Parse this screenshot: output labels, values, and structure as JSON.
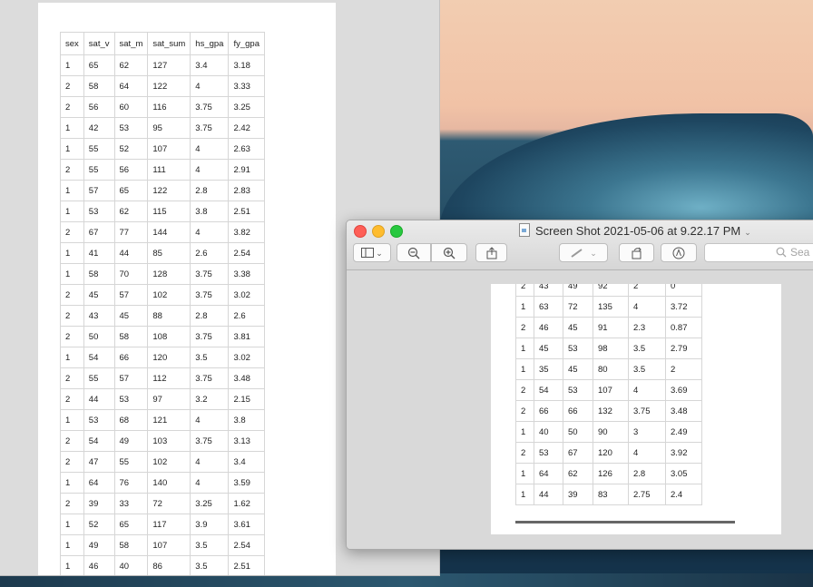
{
  "desktop": {
    "wallpaper": "ocean-wave"
  },
  "left_window": {
    "table": {
      "headers": [
        "sex",
        "sat_v",
        "sat_m",
        "sat_sum",
        "hs_gpa",
        "fy_gpa"
      ],
      "rows": [
        [
          "1",
          "65",
          "62",
          "127",
          "3.4",
          "3.18"
        ],
        [
          "2",
          "58",
          "64",
          "122",
          "4",
          "3.33"
        ],
        [
          "2",
          "56",
          "60",
          "116",
          "3.75",
          "3.25"
        ],
        [
          "1",
          "42",
          "53",
          "95",
          "3.75",
          "2.42"
        ],
        [
          "1",
          "55",
          "52",
          "107",
          "4",
          "2.63"
        ],
        [
          "2",
          "55",
          "56",
          "111",
          "4",
          "2.91"
        ],
        [
          "1",
          "57",
          "65",
          "122",
          "2.8",
          "2.83"
        ],
        [
          "1",
          "53",
          "62",
          "115",
          "3.8",
          "2.51"
        ],
        [
          "2",
          "67",
          "77",
          "144",
          "4",
          "3.82"
        ],
        [
          "1",
          "41",
          "44",
          "85",
          "2.6",
          "2.54"
        ],
        [
          "1",
          "58",
          "70",
          "128",
          "3.75",
          "3.38"
        ],
        [
          "2",
          "45",
          "57",
          "102",
          "3.75",
          "3.02"
        ],
        [
          "2",
          "43",
          "45",
          "88",
          "2.8",
          "2.6"
        ],
        [
          "2",
          "50",
          "58",
          "108",
          "3.75",
          "3.81"
        ],
        [
          "1",
          "54",
          "66",
          "120",
          "3.5",
          "3.02"
        ],
        [
          "2",
          "55",
          "57",
          "112",
          "3.75",
          "3.48"
        ],
        [
          "2",
          "44",
          "53",
          "97",
          "3.2",
          "2.15"
        ],
        [
          "1",
          "53",
          "68",
          "121",
          "4",
          "3.8"
        ],
        [
          "2",
          "54",
          "49",
          "103",
          "3.75",
          "3.13"
        ],
        [
          "2",
          "47",
          "55",
          "102",
          "4",
          "3.4"
        ],
        [
          "1",
          "64",
          "76",
          "140",
          "4",
          "3.59"
        ],
        [
          "2",
          "39",
          "33",
          "72",
          "3.25",
          "1.62"
        ],
        [
          "1",
          "52",
          "65",
          "117",
          "3.9",
          "3.61"
        ],
        [
          "1",
          "49",
          "58",
          "107",
          "3.5",
          "2.54"
        ],
        [
          "1",
          "46",
          "40",
          "86",
          "3.5",
          "2.51"
        ]
      ]
    }
  },
  "preview_window": {
    "title": "Screen Shot 2021-05-06 at 9.22.17 PM",
    "title_chevron": "⌄",
    "search_placeholder": "Sea",
    "toolbar": {
      "sidebar_chevron": "⌄",
      "markup_chevron": "⌄"
    },
    "table": {
      "rows": [
        [
          "2",
          "43",
          "49",
          "92",
          "2",
          "0"
        ],
        [
          "1",
          "63",
          "72",
          "135",
          "4",
          "3.72"
        ],
        [
          "2",
          "46",
          "45",
          "91",
          "2.3",
          "0.87"
        ],
        [
          "1",
          "45",
          "53",
          "98",
          "3.5",
          "2.79"
        ],
        [
          "1",
          "35",
          "45",
          "80",
          "3.5",
          "2"
        ],
        [
          "2",
          "54",
          "53",
          "107",
          "4",
          "3.69"
        ],
        [
          "2",
          "66",
          "66",
          "132",
          "3.75",
          "3.48"
        ],
        [
          "1",
          "40",
          "50",
          "90",
          "3",
          "2.49"
        ],
        [
          "2",
          "53",
          "67",
          "120",
          "4",
          "3.92"
        ],
        [
          "1",
          "64",
          "62",
          "126",
          "2.8",
          "3.05"
        ],
        [
          "1",
          "44",
          "39",
          "83",
          "2.75",
          "2.4"
        ]
      ]
    }
  }
}
